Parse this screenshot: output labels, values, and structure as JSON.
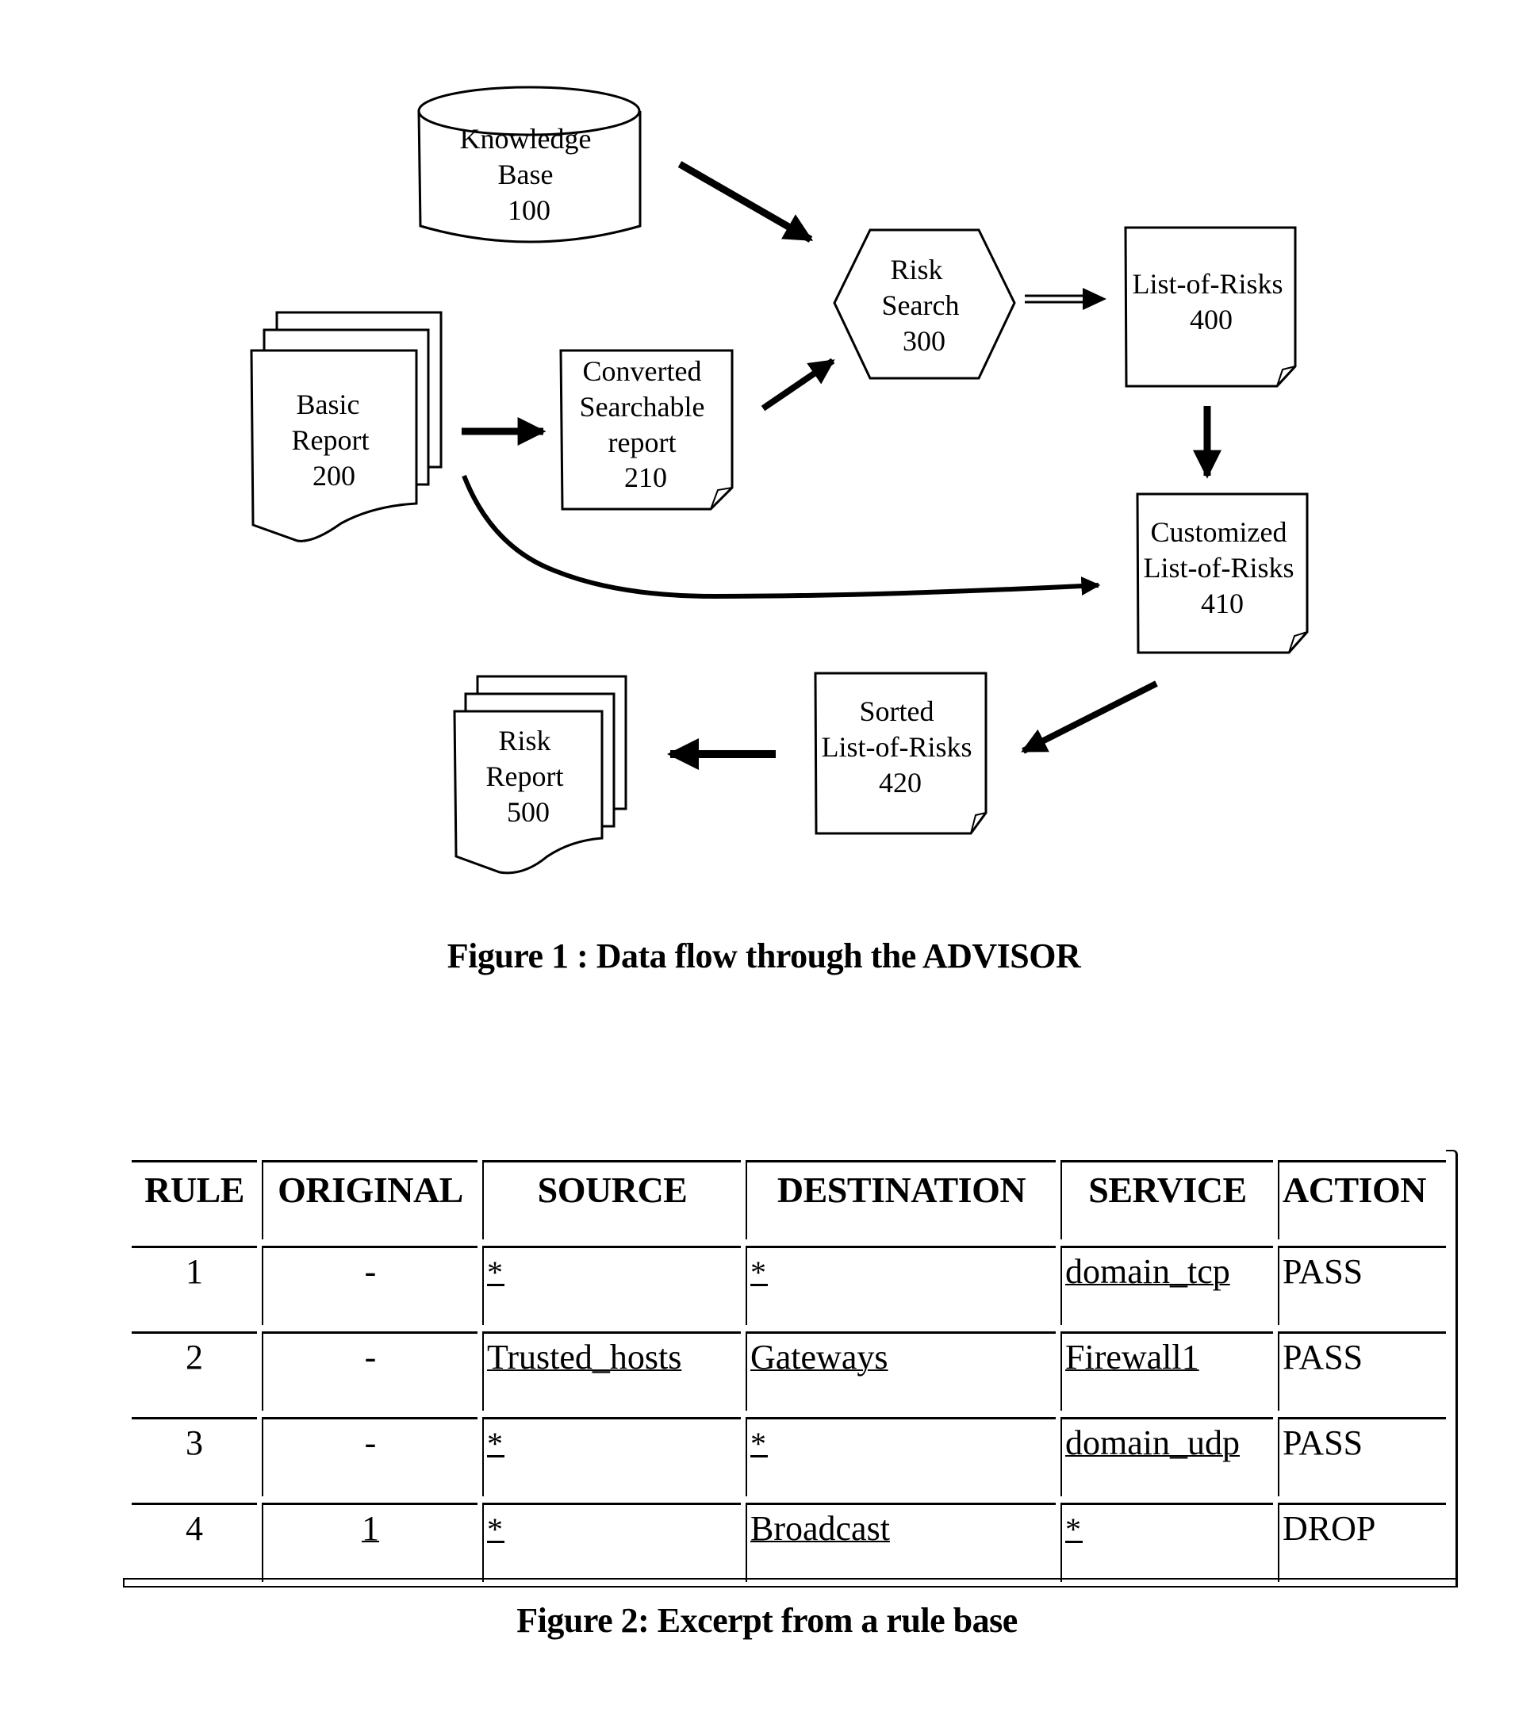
{
  "figure1": {
    "caption": "Figure 1 : Data flow through the ADVISOR",
    "nodes": {
      "knowledge_base": {
        "lines": [
          "Knowledge",
          "Base",
          "100"
        ],
        "shape": "database-cylinder"
      },
      "basic_report": {
        "lines": [
          "Basic",
          "Report",
          "200"
        ],
        "shape": "multi-document"
      },
      "converted_report": {
        "lines": [
          "Converted",
          "Searchable",
          "report",
          "210"
        ],
        "shape": "document-folded-corner"
      },
      "risk_search": {
        "lines": [
          "Risk",
          "Search",
          "300"
        ],
        "shape": "hexagon"
      },
      "list_of_risks": {
        "lines": [
          "List-of-Risks",
          "400"
        ],
        "shape": "document-folded-corner"
      },
      "customized_list": {
        "lines": [
          "Customized",
          "List-of-Risks",
          "410"
        ],
        "shape": "document-folded-corner"
      },
      "sorted_list": {
        "lines": [
          "Sorted",
          "List-of-Risks",
          "420"
        ],
        "shape": "document-folded-corner"
      },
      "risk_report": {
        "lines": [
          "Risk",
          "Report",
          "500"
        ],
        "shape": "multi-document"
      }
    },
    "edges": [
      {
        "from": "knowledge_base",
        "to": "risk_search"
      },
      {
        "from": "basic_report",
        "to": "converted_report"
      },
      {
        "from": "converted_report",
        "to": "risk_search"
      },
      {
        "from": "risk_search",
        "to": "list_of_risks"
      },
      {
        "from": "list_of_risks",
        "to": "customized_list"
      },
      {
        "from": "basic_report",
        "to": "customized_list",
        "style": "curved"
      },
      {
        "from": "customized_list",
        "to": "sorted_list"
      },
      {
        "from": "sorted_list",
        "to": "risk_report"
      }
    ]
  },
  "figure2": {
    "caption": "Figure 2: Excerpt from a rule base",
    "columns": [
      "RULE",
      "ORIGINAL",
      "SOURCE",
      "DESTINATION",
      "SERVICE",
      "ACTION"
    ],
    "rows": [
      {
        "rule": "1",
        "original": "-",
        "source": "*",
        "destination": "*",
        "service": "domain_tcp",
        "action": "PASS"
      },
      {
        "rule": "2",
        "original": "-",
        "source": "Trusted_hosts",
        "destination": "Gateways",
        "service": "Firewall1",
        "action": "PASS"
      },
      {
        "rule": "3",
        "original": "-",
        "source": "*",
        "destination": "*",
        "service": "domain_udp",
        "action": "PASS"
      },
      {
        "rule": "4",
        "original": "1",
        "source": "*",
        "destination": "Broadcast",
        "service": "*",
        "action": "DROP"
      }
    ]
  }
}
